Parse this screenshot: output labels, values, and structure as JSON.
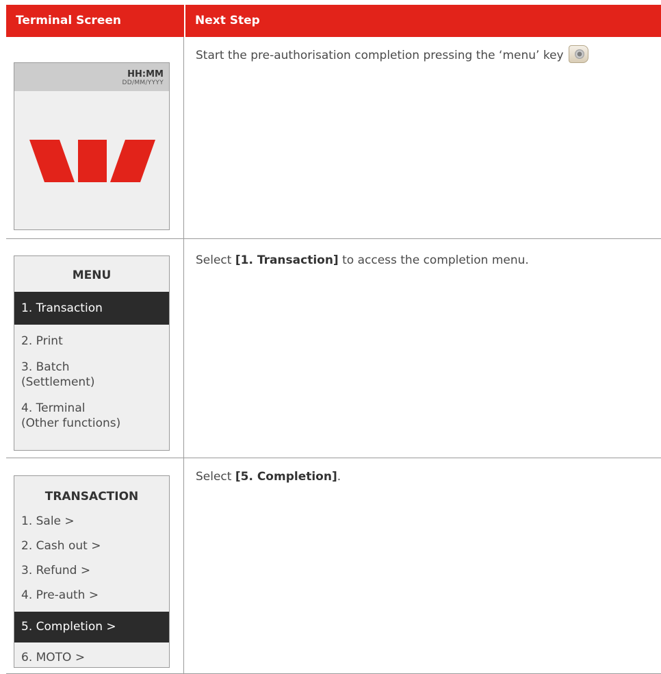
{
  "header": {
    "col1": "Terminal Screen",
    "col2": "Next Step"
  },
  "rows": [
    {
      "screen": {
        "time": "HH:MM",
        "date": "DD/MM/YYYY",
        "logo_icon": "westpac-logo-icon"
      },
      "step": {
        "text_before": "Start the pre-authorisation completion pressing the ‘menu’ key",
        "key_icon": "menu-key-icon"
      }
    },
    {
      "screen": {
        "title": "MENU",
        "items": [
          "1. Transaction",
          "2. Print",
          "3. Batch",
          "(Settlement)",
          "4. Terminal",
          "(Other functions)"
        ],
        "selected": "1. Transaction"
      },
      "step": {
        "before": "Select ",
        "bold": "[1. Transaction]",
        "after": " to access the completion menu."
      }
    },
    {
      "screen": {
        "title": "TRANSACTION",
        "items": [
          "1. Sale >",
          "2. Cash out >",
          "3. Refund >",
          "4. Pre-auth >",
          "5. Completion >",
          "6. MOTO >"
        ],
        "selected": "5. Completion >"
      },
      "step": {
        "before": "Select ",
        "bold": "[5. Completion]",
        "after": "."
      }
    }
  ],
  "colors": {
    "header_bg": "#e2231a",
    "logo": "#e2231a",
    "selected_bg": "#2b2b2b"
  }
}
